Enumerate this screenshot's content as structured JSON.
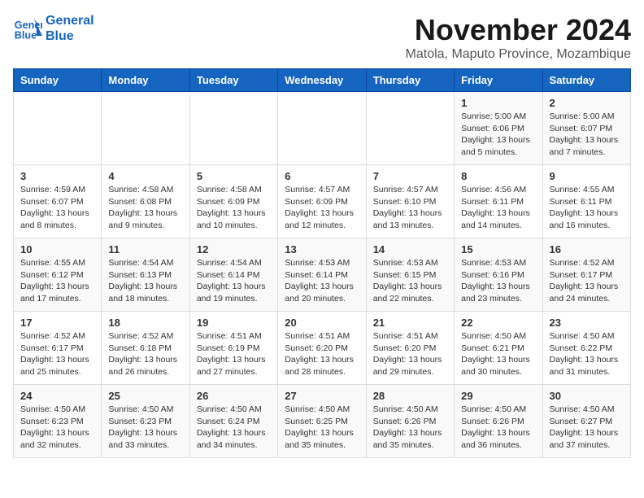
{
  "header": {
    "logo_line1": "General",
    "logo_line2": "Blue",
    "title": "November 2024",
    "subtitle": "Matola, Maputo Province, Mozambique"
  },
  "days_of_week": [
    "Sunday",
    "Monday",
    "Tuesday",
    "Wednesday",
    "Thursday",
    "Friday",
    "Saturday"
  ],
  "weeks": [
    [
      {
        "day": "",
        "info": ""
      },
      {
        "day": "",
        "info": ""
      },
      {
        "day": "",
        "info": ""
      },
      {
        "day": "",
        "info": ""
      },
      {
        "day": "",
        "info": ""
      },
      {
        "day": "1",
        "info": "Sunrise: 5:00 AM\nSunset: 6:06 PM\nDaylight: 13 hours\nand 5 minutes."
      },
      {
        "day": "2",
        "info": "Sunrise: 5:00 AM\nSunset: 6:07 PM\nDaylight: 13 hours\nand 7 minutes."
      }
    ],
    [
      {
        "day": "3",
        "info": "Sunrise: 4:59 AM\nSunset: 6:07 PM\nDaylight: 13 hours\nand 8 minutes."
      },
      {
        "day": "4",
        "info": "Sunrise: 4:58 AM\nSunset: 6:08 PM\nDaylight: 13 hours\nand 9 minutes."
      },
      {
        "day": "5",
        "info": "Sunrise: 4:58 AM\nSunset: 6:09 PM\nDaylight: 13 hours\nand 10 minutes."
      },
      {
        "day": "6",
        "info": "Sunrise: 4:57 AM\nSunset: 6:09 PM\nDaylight: 13 hours\nand 12 minutes."
      },
      {
        "day": "7",
        "info": "Sunrise: 4:57 AM\nSunset: 6:10 PM\nDaylight: 13 hours\nand 13 minutes."
      },
      {
        "day": "8",
        "info": "Sunrise: 4:56 AM\nSunset: 6:11 PM\nDaylight: 13 hours\nand 14 minutes."
      },
      {
        "day": "9",
        "info": "Sunrise: 4:55 AM\nSunset: 6:11 PM\nDaylight: 13 hours\nand 16 minutes."
      }
    ],
    [
      {
        "day": "10",
        "info": "Sunrise: 4:55 AM\nSunset: 6:12 PM\nDaylight: 13 hours\nand 17 minutes."
      },
      {
        "day": "11",
        "info": "Sunrise: 4:54 AM\nSunset: 6:13 PM\nDaylight: 13 hours\nand 18 minutes."
      },
      {
        "day": "12",
        "info": "Sunrise: 4:54 AM\nSunset: 6:14 PM\nDaylight: 13 hours\nand 19 minutes."
      },
      {
        "day": "13",
        "info": "Sunrise: 4:53 AM\nSunset: 6:14 PM\nDaylight: 13 hours\nand 20 minutes."
      },
      {
        "day": "14",
        "info": "Sunrise: 4:53 AM\nSunset: 6:15 PM\nDaylight: 13 hours\nand 22 minutes."
      },
      {
        "day": "15",
        "info": "Sunrise: 4:53 AM\nSunset: 6:16 PM\nDaylight: 13 hours\nand 23 minutes."
      },
      {
        "day": "16",
        "info": "Sunrise: 4:52 AM\nSunset: 6:17 PM\nDaylight: 13 hours\nand 24 minutes."
      }
    ],
    [
      {
        "day": "17",
        "info": "Sunrise: 4:52 AM\nSunset: 6:17 PM\nDaylight: 13 hours\nand 25 minutes."
      },
      {
        "day": "18",
        "info": "Sunrise: 4:52 AM\nSunset: 6:18 PM\nDaylight: 13 hours\nand 26 minutes."
      },
      {
        "day": "19",
        "info": "Sunrise: 4:51 AM\nSunset: 6:19 PM\nDaylight: 13 hours\nand 27 minutes."
      },
      {
        "day": "20",
        "info": "Sunrise: 4:51 AM\nSunset: 6:20 PM\nDaylight: 13 hours\nand 28 minutes."
      },
      {
        "day": "21",
        "info": "Sunrise: 4:51 AM\nSunset: 6:20 PM\nDaylight: 13 hours\nand 29 minutes."
      },
      {
        "day": "22",
        "info": "Sunrise: 4:50 AM\nSunset: 6:21 PM\nDaylight: 13 hours\nand 30 minutes."
      },
      {
        "day": "23",
        "info": "Sunrise: 4:50 AM\nSunset: 6:22 PM\nDaylight: 13 hours\nand 31 minutes."
      }
    ],
    [
      {
        "day": "24",
        "info": "Sunrise: 4:50 AM\nSunset: 6:23 PM\nDaylight: 13 hours\nand 32 minutes."
      },
      {
        "day": "25",
        "info": "Sunrise: 4:50 AM\nSunset: 6:23 PM\nDaylight: 13 hours\nand 33 minutes."
      },
      {
        "day": "26",
        "info": "Sunrise: 4:50 AM\nSunset: 6:24 PM\nDaylight: 13 hours\nand 34 minutes."
      },
      {
        "day": "27",
        "info": "Sunrise: 4:50 AM\nSunset: 6:25 PM\nDaylight: 13 hours\nand 35 minutes."
      },
      {
        "day": "28",
        "info": "Sunrise: 4:50 AM\nSunset: 6:26 PM\nDaylight: 13 hours\nand 35 minutes."
      },
      {
        "day": "29",
        "info": "Sunrise: 4:50 AM\nSunset: 6:26 PM\nDaylight: 13 hours\nand 36 minutes."
      },
      {
        "day": "30",
        "info": "Sunrise: 4:50 AM\nSunset: 6:27 PM\nDaylight: 13 hours\nand 37 minutes."
      }
    ]
  ]
}
